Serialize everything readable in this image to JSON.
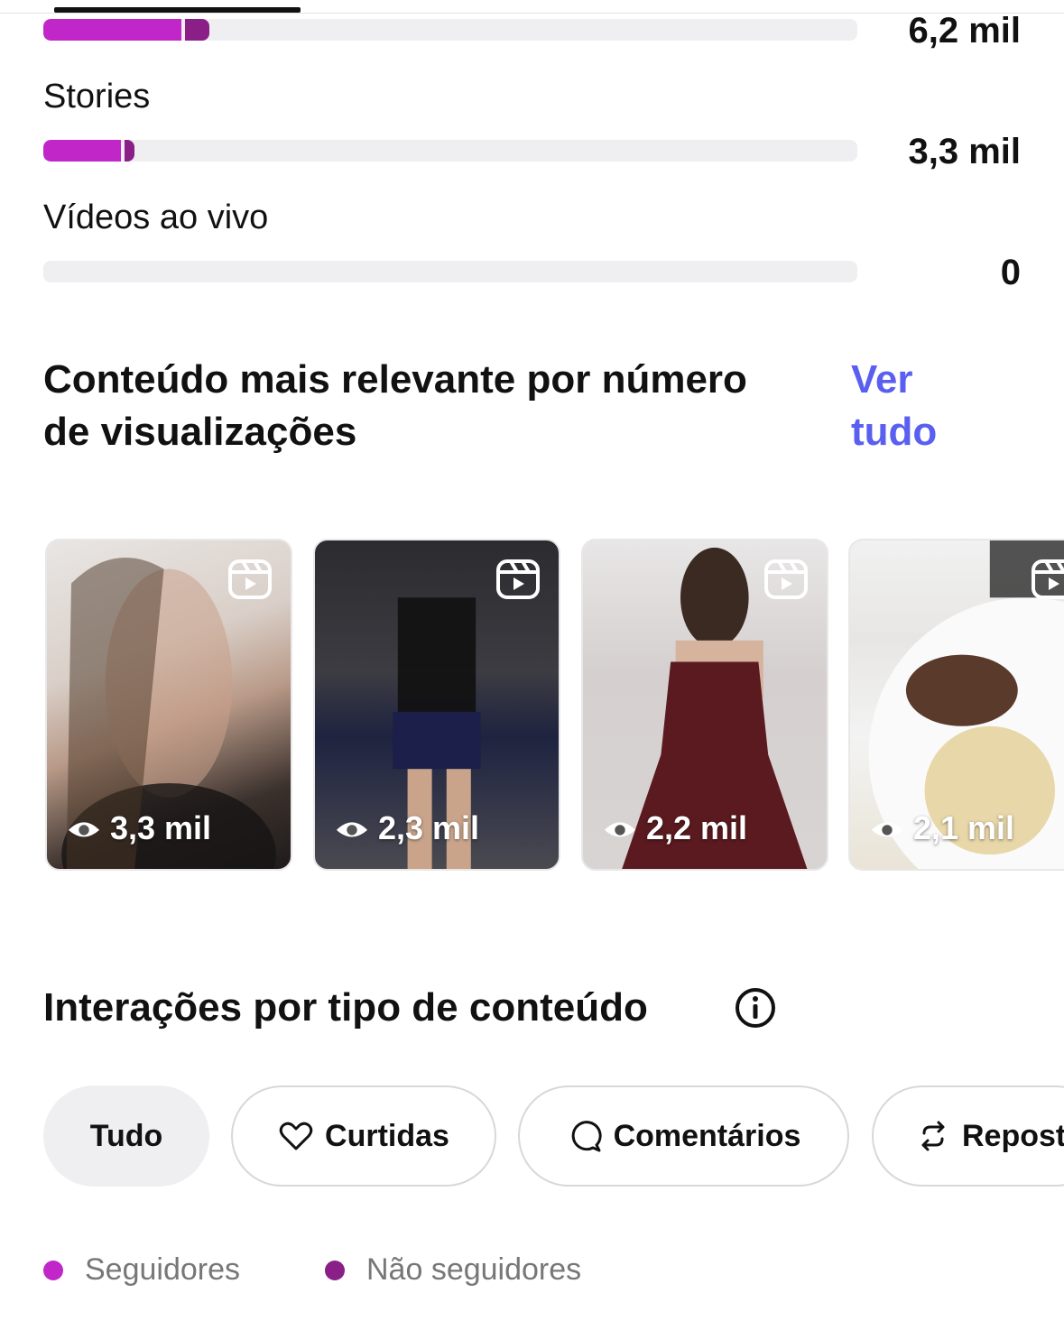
{
  "metrics": [
    {
      "label": "",
      "value": "6,2 mil",
      "followers_fraction": 0.17,
      "non_followers_fraction": 0.03
    },
    {
      "label": "Stories",
      "value": "3,3 mil",
      "followers_fraction": 0.095,
      "non_followers_fraction": 0.012
    },
    {
      "label": "Vídeos ao vivo",
      "value": "0",
      "followers_fraction": 0,
      "non_followers_fraction": 0
    }
  ],
  "top_content": {
    "title_line1": "Conteúdo mais relevante por número",
    "title_line2": "de visualizações",
    "see_all_line1": "Ver",
    "see_all_line2": "tudo",
    "items": [
      {
        "views": "3,3 mil",
        "icon": "reel-icon"
      },
      {
        "views": "2,3 mil",
        "icon": "reel-icon"
      },
      {
        "views": "2,2 mil",
        "icon": "reel-icon"
      },
      {
        "views": "2,1 mil",
        "icon": "reel-icon"
      }
    ]
  },
  "interactions": {
    "title": "Interações por tipo de conteúdo",
    "chips": [
      "Tudo",
      "Curtidas",
      "Comentários",
      "Repost"
    ]
  },
  "legend": {
    "followers": "Seguidores",
    "non_followers": "Não seguidores"
  },
  "colors": {
    "followers": "#c126c9",
    "non_followers": "#8a1f87",
    "link": "#5b5ff0"
  }
}
